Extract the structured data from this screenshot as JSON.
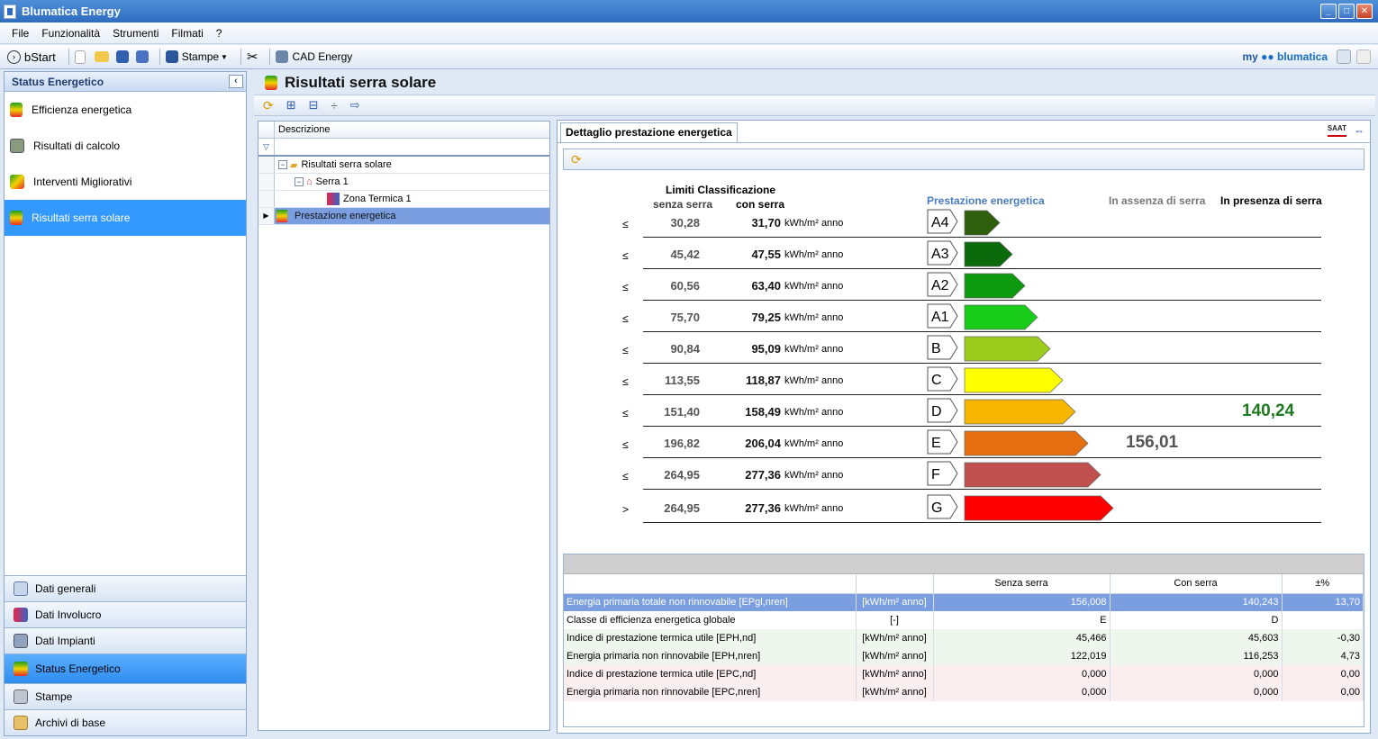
{
  "window": {
    "title": "Blumatica Energy"
  },
  "menu": [
    "File",
    "Funzionalità",
    "Strumenti",
    "Filmati",
    "?"
  ],
  "toolbar": {
    "bstart": "bStart",
    "stampe": "Stampe",
    "cad": "CAD Energy",
    "brand_my": "my",
    "brand_name": "blumatica"
  },
  "sidebar": {
    "title": "Status Energetico",
    "items": [
      {
        "label": "Efficienza energetica",
        "icon": "energy-label-icon"
      },
      {
        "label": "Risultati di calcolo",
        "icon": "calculator-icon"
      },
      {
        "label": "Interventi Migliorativi",
        "icon": "improvement-icon"
      },
      {
        "label": "Risultati serra solare",
        "icon": "energy-label-icon"
      }
    ],
    "nav": [
      {
        "label": "Dati generali",
        "icon": "house-icon"
      },
      {
        "label": "Dati Involucro",
        "icon": "envelope-icon"
      },
      {
        "label": "Dati Impianti",
        "icon": "plant-icon"
      },
      {
        "label": "Status Energetico",
        "icon": "energy-label-icon"
      },
      {
        "label": "Stampe",
        "icon": "printer-icon"
      },
      {
        "label": "Archivi di base",
        "icon": "archive-icon"
      }
    ]
  },
  "main": {
    "title": "Risultati serra solare"
  },
  "tree": {
    "column": "Descrizione",
    "nodes": [
      "Risultati serra solare",
      "Serra 1",
      "Zona Termica 1",
      "Prestazione energetica"
    ]
  },
  "detail": {
    "tab": "Dettaglio prestazione energetica",
    "header_limits": "Limiti Classificazione",
    "header_senza": "senza serra",
    "header_con": "con serra",
    "header_prest": "Prestazione energetica",
    "header_assenza": "In assenza di serra",
    "header_presenza": "In presenza di serra",
    "unit": "kWh/m² anno",
    "classes": [
      {
        "op": "≤",
        "senza": "30,28",
        "con": "31,70",
        "label": "A4",
        "color": "#2e5f0c"
      },
      {
        "op": "≤",
        "senza": "45,42",
        "con": "47,55",
        "label": "A3",
        "color": "#0b6a0b"
      },
      {
        "op": "≤",
        "senza": "60,56",
        "con": "63,40",
        "label": "A2",
        "color": "#0e9a0e"
      },
      {
        "op": "≤",
        "senza": "75,70",
        "con": "79,25",
        "label": "A1",
        "color": "#19cc19"
      },
      {
        "op": "≤",
        "senza": "90,84",
        "con": "95,09",
        "label": "B",
        "color": "#9ccc1e"
      },
      {
        "op": "≤",
        "senza": "113,55",
        "con": "118,87",
        "label": "C",
        "color": "#ffff00"
      },
      {
        "op": "≤",
        "senza": "151,40",
        "con": "158,49",
        "label": "D",
        "color": "#f8b500"
      },
      {
        "op": "≤",
        "senza": "196,82",
        "con": "206,04",
        "label": "E",
        "color": "#e46e10"
      },
      {
        "op": "≤",
        "senza": "264,95",
        "con": "277,36",
        "label": "F",
        "color": "#c0504d"
      },
      {
        "op": ">",
        "senza": "264,95",
        "con": "277,36",
        "label": "G",
        "color": "#ff0000"
      }
    ],
    "value_assenza": "156,01",
    "value_presenza": "140,24",
    "value_presenza_color": "#1f7a1f",
    "table": {
      "headers": [
        "",
        "",
        "Senza serra",
        "Con serra",
        "±%"
      ],
      "rows": [
        [
          "Energia primaria totale non rinnovabile [EPgl,nren]",
          "[kWh/m² anno]",
          "156,008",
          "140,243",
          "13,70"
        ],
        [
          "Classe di efficienza energetica globale",
          "[-]",
          "E",
          "D",
          ""
        ],
        [
          "Indice di prestazione termica utile [EPH,nd]",
          "[kWh/m² anno]",
          "45,466",
          "45,603",
          "-0,30"
        ],
        [
          "Energia primaria non rinnovabile [EPH,nren]",
          "[kWh/m² anno]",
          "122,019",
          "116,253",
          "4,73"
        ],
        [
          "Indice di prestazione termica utile [EPC,nd]",
          "[kWh/m² anno]",
          "0,000",
          "0,000",
          "0,00"
        ],
        [
          "Energia primaria non rinnovabile [EPC,nren]",
          "[kWh/m² anno]",
          "0,000",
          "0,000",
          "0,00"
        ]
      ]
    }
  }
}
